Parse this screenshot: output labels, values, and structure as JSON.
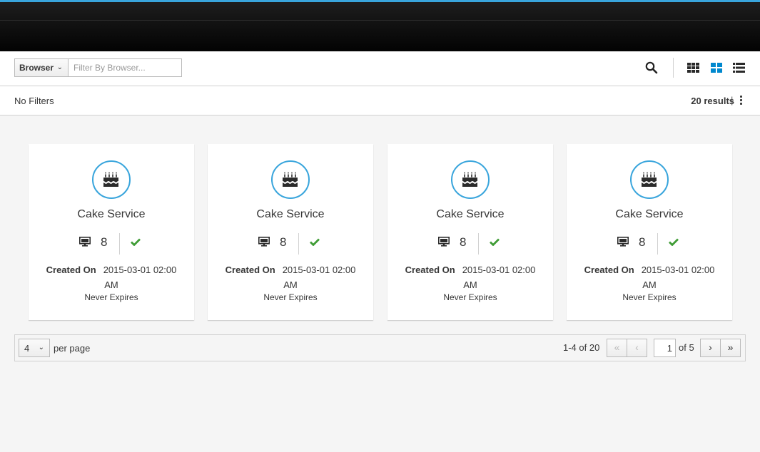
{
  "toolbar": {
    "filter_field_label": "Browser",
    "filter_placeholder": "Filter By Browser...",
    "search_icon": "search-icon",
    "view_icons": [
      "small-cards-view-icon",
      "large-cards-view-icon",
      "list-view-icon"
    ],
    "active_view": "large-cards-view-icon"
  },
  "results": {
    "filters_label": "No Filters",
    "count_label": "20 results",
    "separator": "|",
    "menu_icon": "kebab-icon"
  },
  "cards": [
    {
      "icon": "birthday-cake-icon",
      "title": "Cake Service",
      "count": "8",
      "status_icon": "check-icon",
      "created_label": "Created On",
      "created_value": "2015-03-01 02:00 AM",
      "expires": "Never Expires"
    },
    {
      "icon": "birthday-cake-icon",
      "title": "Cake Service",
      "count": "8",
      "status_icon": "check-icon",
      "created_label": "Created On",
      "created_value": "2015-03-01 02:00 AM",
      "expires": "Never Expires"
    },
    {
      "icon": "birthday-cake-icon",
      "title": "Cake Service",
      "count": "8",
      "status_icon": "check-icon",
      "created_label": "Created On",
      "created_value": "2015-03-01 02:00 AM",
      "expires": "Never Expires"
    },
    {
      "icon": "birthday-cake-icon",
      "title": "Cake Service",
      "count": "8",
      "status_icon": "check-icon",
      "created_label": "Created On",
      "created_value": "2015-03-01 02:00 AM",
      "expires": "Never Expires"
    }
  ],
  "pagination": {
    "per_page_value": "4",
    "per_page_label": "per page",
    "range_label": "1-4 of 20",
    "current_page": "1",
    "of_pages_label": "of 5"
  },
  "colors": {
    "accent": "#39a5dc",
    "success": "#3f9c35",
    "masthead": "#030303"
  }
}
